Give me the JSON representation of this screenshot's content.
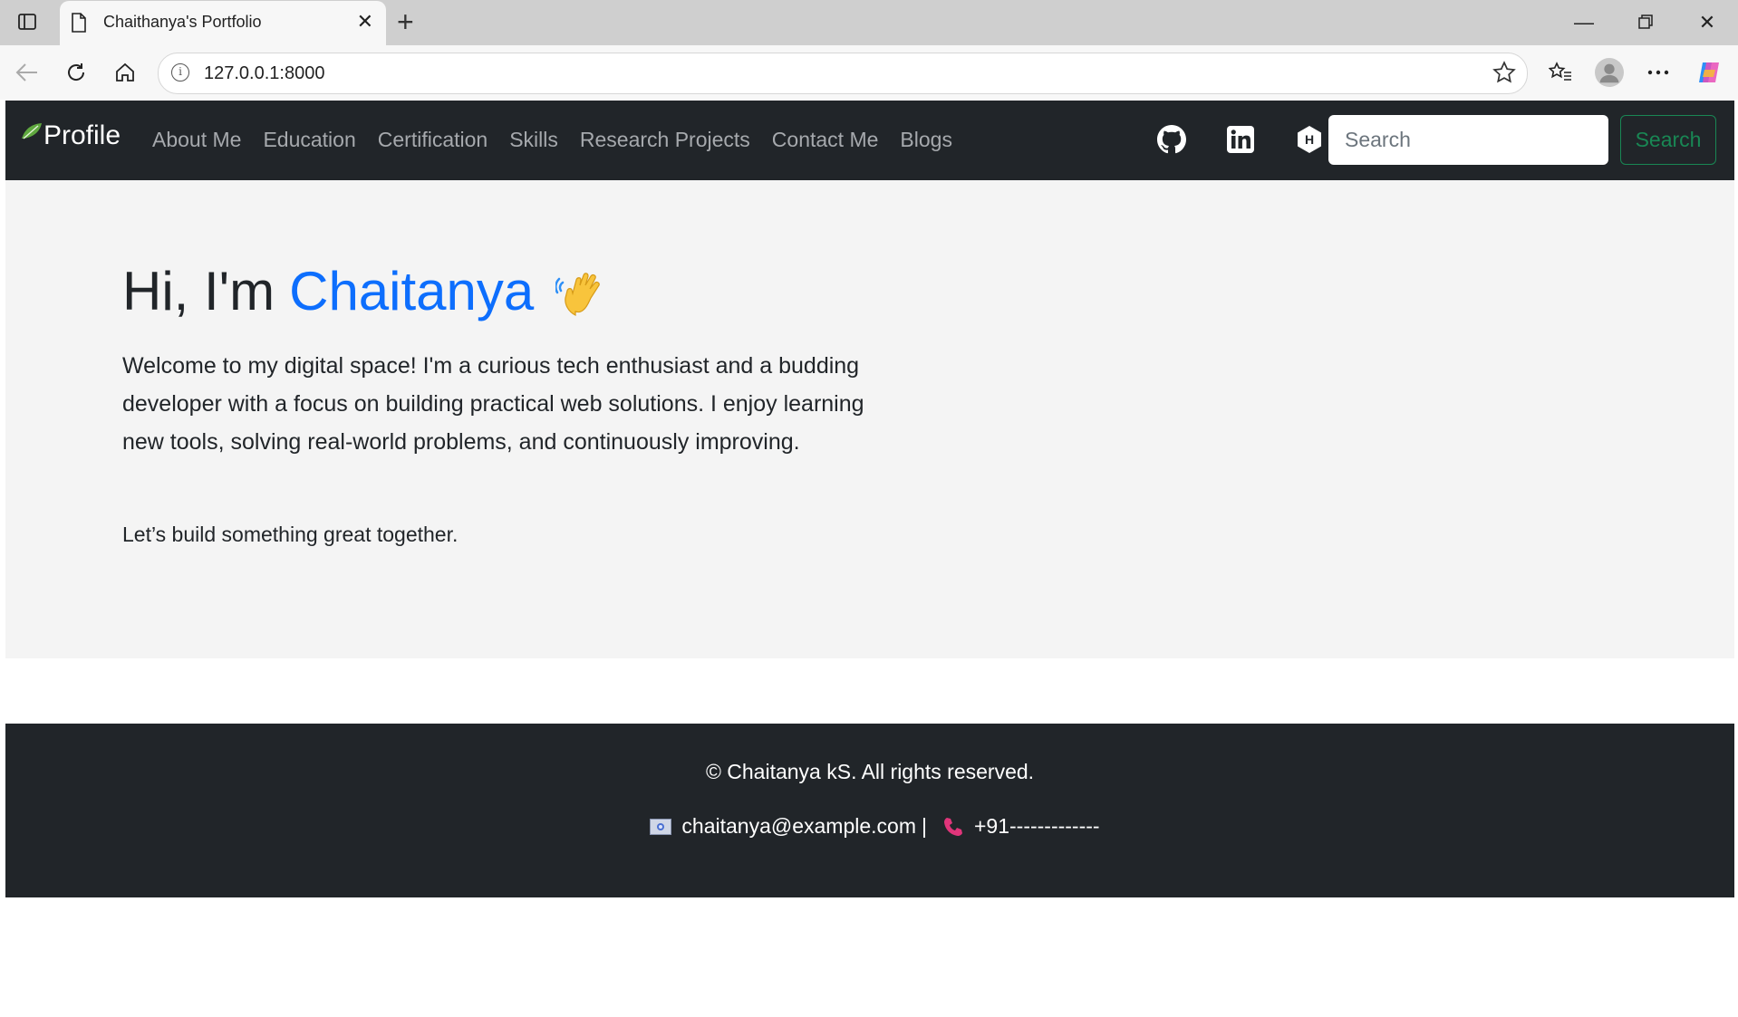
{
  "browser": {
    "tab_title": "Chaithanya's Portfolio",
    "url": "127.0.0.1:8000"
  },
  "navbar": {
    "brand": "Profile",
    "links": [
      "About Me",
      "Education",
      "Certification",
      "Skills",
      "Research Projects",
      "Contact Me",
      "Blogs"
    ],
    "social_icons": [
      "github-icon",
      "linkedin-icon",
      "hashnode-icon"
    ],
    "search_placeholder": "Search",
    "search_button": "Search"
  },
  "hero": {
    "greeting": "Hi, I'm",
    "name": "Chaitanya",
    "wave_icon": "waving-hand-icon",
    "intro": "Welcome to my digital space! I'm a curious tech enthusiast and a budding developer with a focus on building practical web solutions. I enjoy learning new tools, solving real-world problems, and continuously improving.",
    "cta": "Let’s build something great together."
  },
  "footer": {
    "copyright": "© Chaitanya kS. All rights reserved.",
    "email": "chaitanya@example.com",
    "separator": "|",
    "phone": "+91-------------"
  },
  "colors": {
    "navbar_bg": "#212529",
    "accent": "#0d6efd",
    "search_button": "#198754",
    "hero_bg": "#f4f4f4"
  }
}
